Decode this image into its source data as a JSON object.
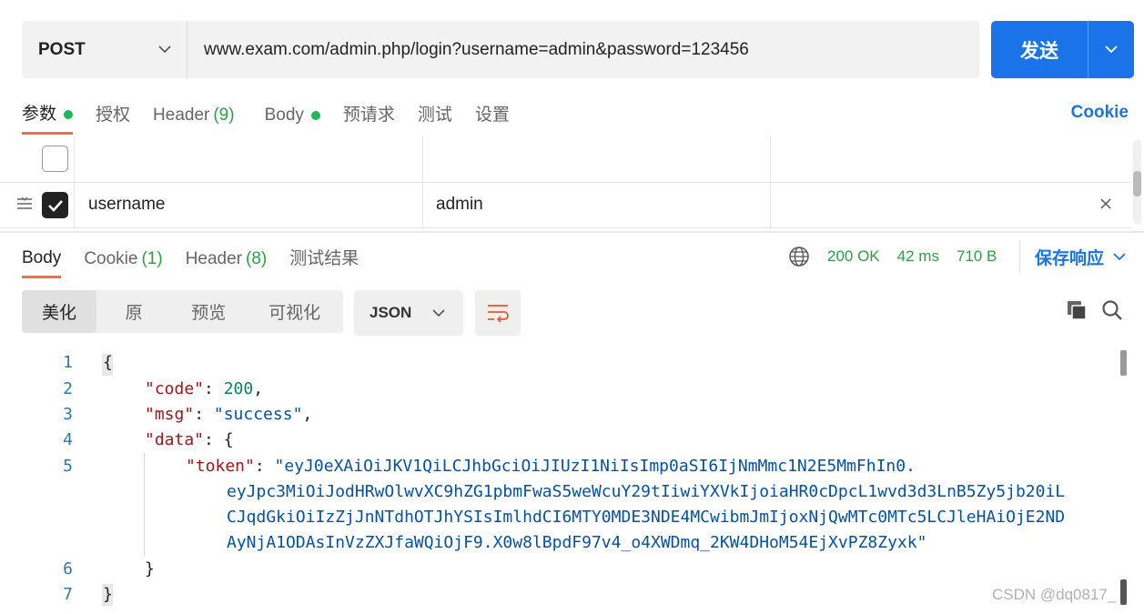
{
  "request": {
    "method": "POST",
    "url": "www.exam.com/admin.php/login?username=admin&password=123456",
    "send_label": "发送"
  },
  "request_tabs": {
    "params": "参数",
    "auth": "授权",
    "header": "Header",
    "header_count": "(9)",
    "body": "Body",
    "prerequest": "预请求",
    "tests": "测试",
    "settings": "设置",
    "cookie": "Cookie"
  },
  "params": {
    "rows": [
      {
        "checked": false,
        "key": "",
        "value": ""
      },
      {
        "checked": true,
        "key": "username",
        "value": "admin"
      }
    ]
  },
  "response_tabs": {
    "body": "Body",
    "cookie": "Cookie",
    "cookie_count": "(1)",
    "header": "Header",
    "header_count": "(8)",
    "test_results": "测试结果"
  },
  "response_status": {
    "status": "200 OK",
    "time": "42 ms",
    "size": "710 B",
    "save_label": "保存响应"
  },
  "view": {
    "modes": [
      "美化",
      "原",
      "预览",
      "可视化"
    ],
    "active_mode": "美化",
    "format": "JSON"
  },
  "code": {
    "line_numbers": [
      "1",
      "2",
      "3",
      "4",
      "5",
      "6",
      "7"
    ],
    "open_brace": "{",
    "close_brace": "}",
    "code_key": "\"code\"",
    "code_value": "200",
    "msg_key": "\"msg\"",
    "msg_value": "\"success\"",
    "data_key": "\"data\"",
    "token_key": "\"token\"",
    "token_lines": [
      "\"eyJ0eXAiOiJKV1QiLCJhbGciOiJIUzI1NiIsImp0aSI6IjNmMmc1N2E5MmFhIn0.",
      "eyJpc3MiOiJodHRwOlwvXC9hZG1pbmFwaS5weWcuY29tIiwiYXVkIjoiaHR0cDpcL1wvd3d3LnB5Zy5jb20iL",
      "CJqdGkiOiIzZjJnNTdhOTJhYSIsImlhdCI6MTY0MDE3NDE4MCwibmJmIjoxNjQwMTc0MTc5LCJleHAiOjE2ND",
      "AyNjA1ODAsInVzZXJfaWQiOjF9.X0w8lBpdF97v4_o4XWDmq_2KW4DHoM54EjXvPZ8Zyxk\""
    ]
  },
  "watermark": "CSDN @dq0817_"
}
